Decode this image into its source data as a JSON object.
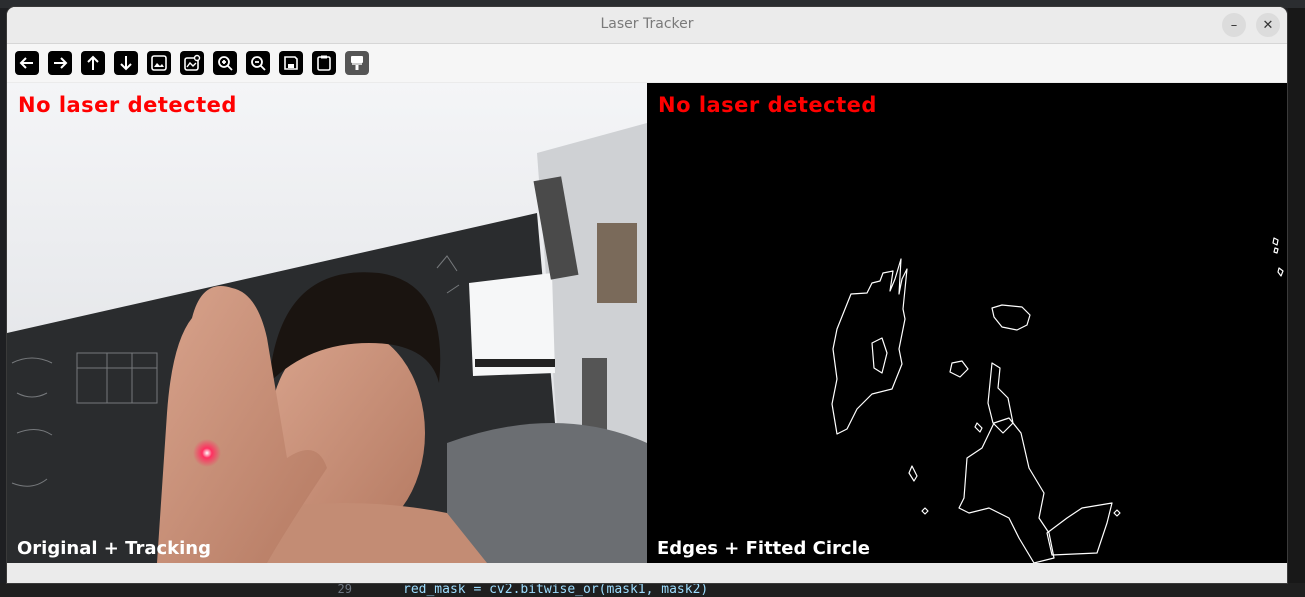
{
  "window": {
    "title": "Laser Tracker"
  },
  "toolbar": {
    "buttons": [
      {
        "name": "arrow-left-icon"
      },
      {
        "name": "arrow-right-icon"
      },
      {
        "name": "arrow-up-icon"
      },
      {
        "name": "arrow-down-icon"
      },
      {
        "name": "image-icon"
      },
      {
        "name": "image-settings-icon"
      },
      {
        "name": "zoom-in-icon"
      },
      {
        "name": "zoom-out-icon"
      },
      {
        "name": "save-icon"
      },
      {
        "name": "clipboard-icon"
      },
      {
        "name": "paint-icon"
      }
    ]
  },
  "panels": {
    "left": {
      "status": "No laser detected",
      "caption": "Original + Tracking"
    },
    "right": {
      "status": "No laser detected",
      "caption": "Edges + Fitted Circle"
    }
  },
  "editor": {
    "line_number": "29",
    "code": "red_mask = cv2.bitwise_or(mask1, mask2)"
  },
  "colors": {
    "status_text": "#ff0000",
    "caption_text": "#ffffff",
    "edge_lines": "#ffffff",
    "laser_dot": "#ff3060"
  }
}
